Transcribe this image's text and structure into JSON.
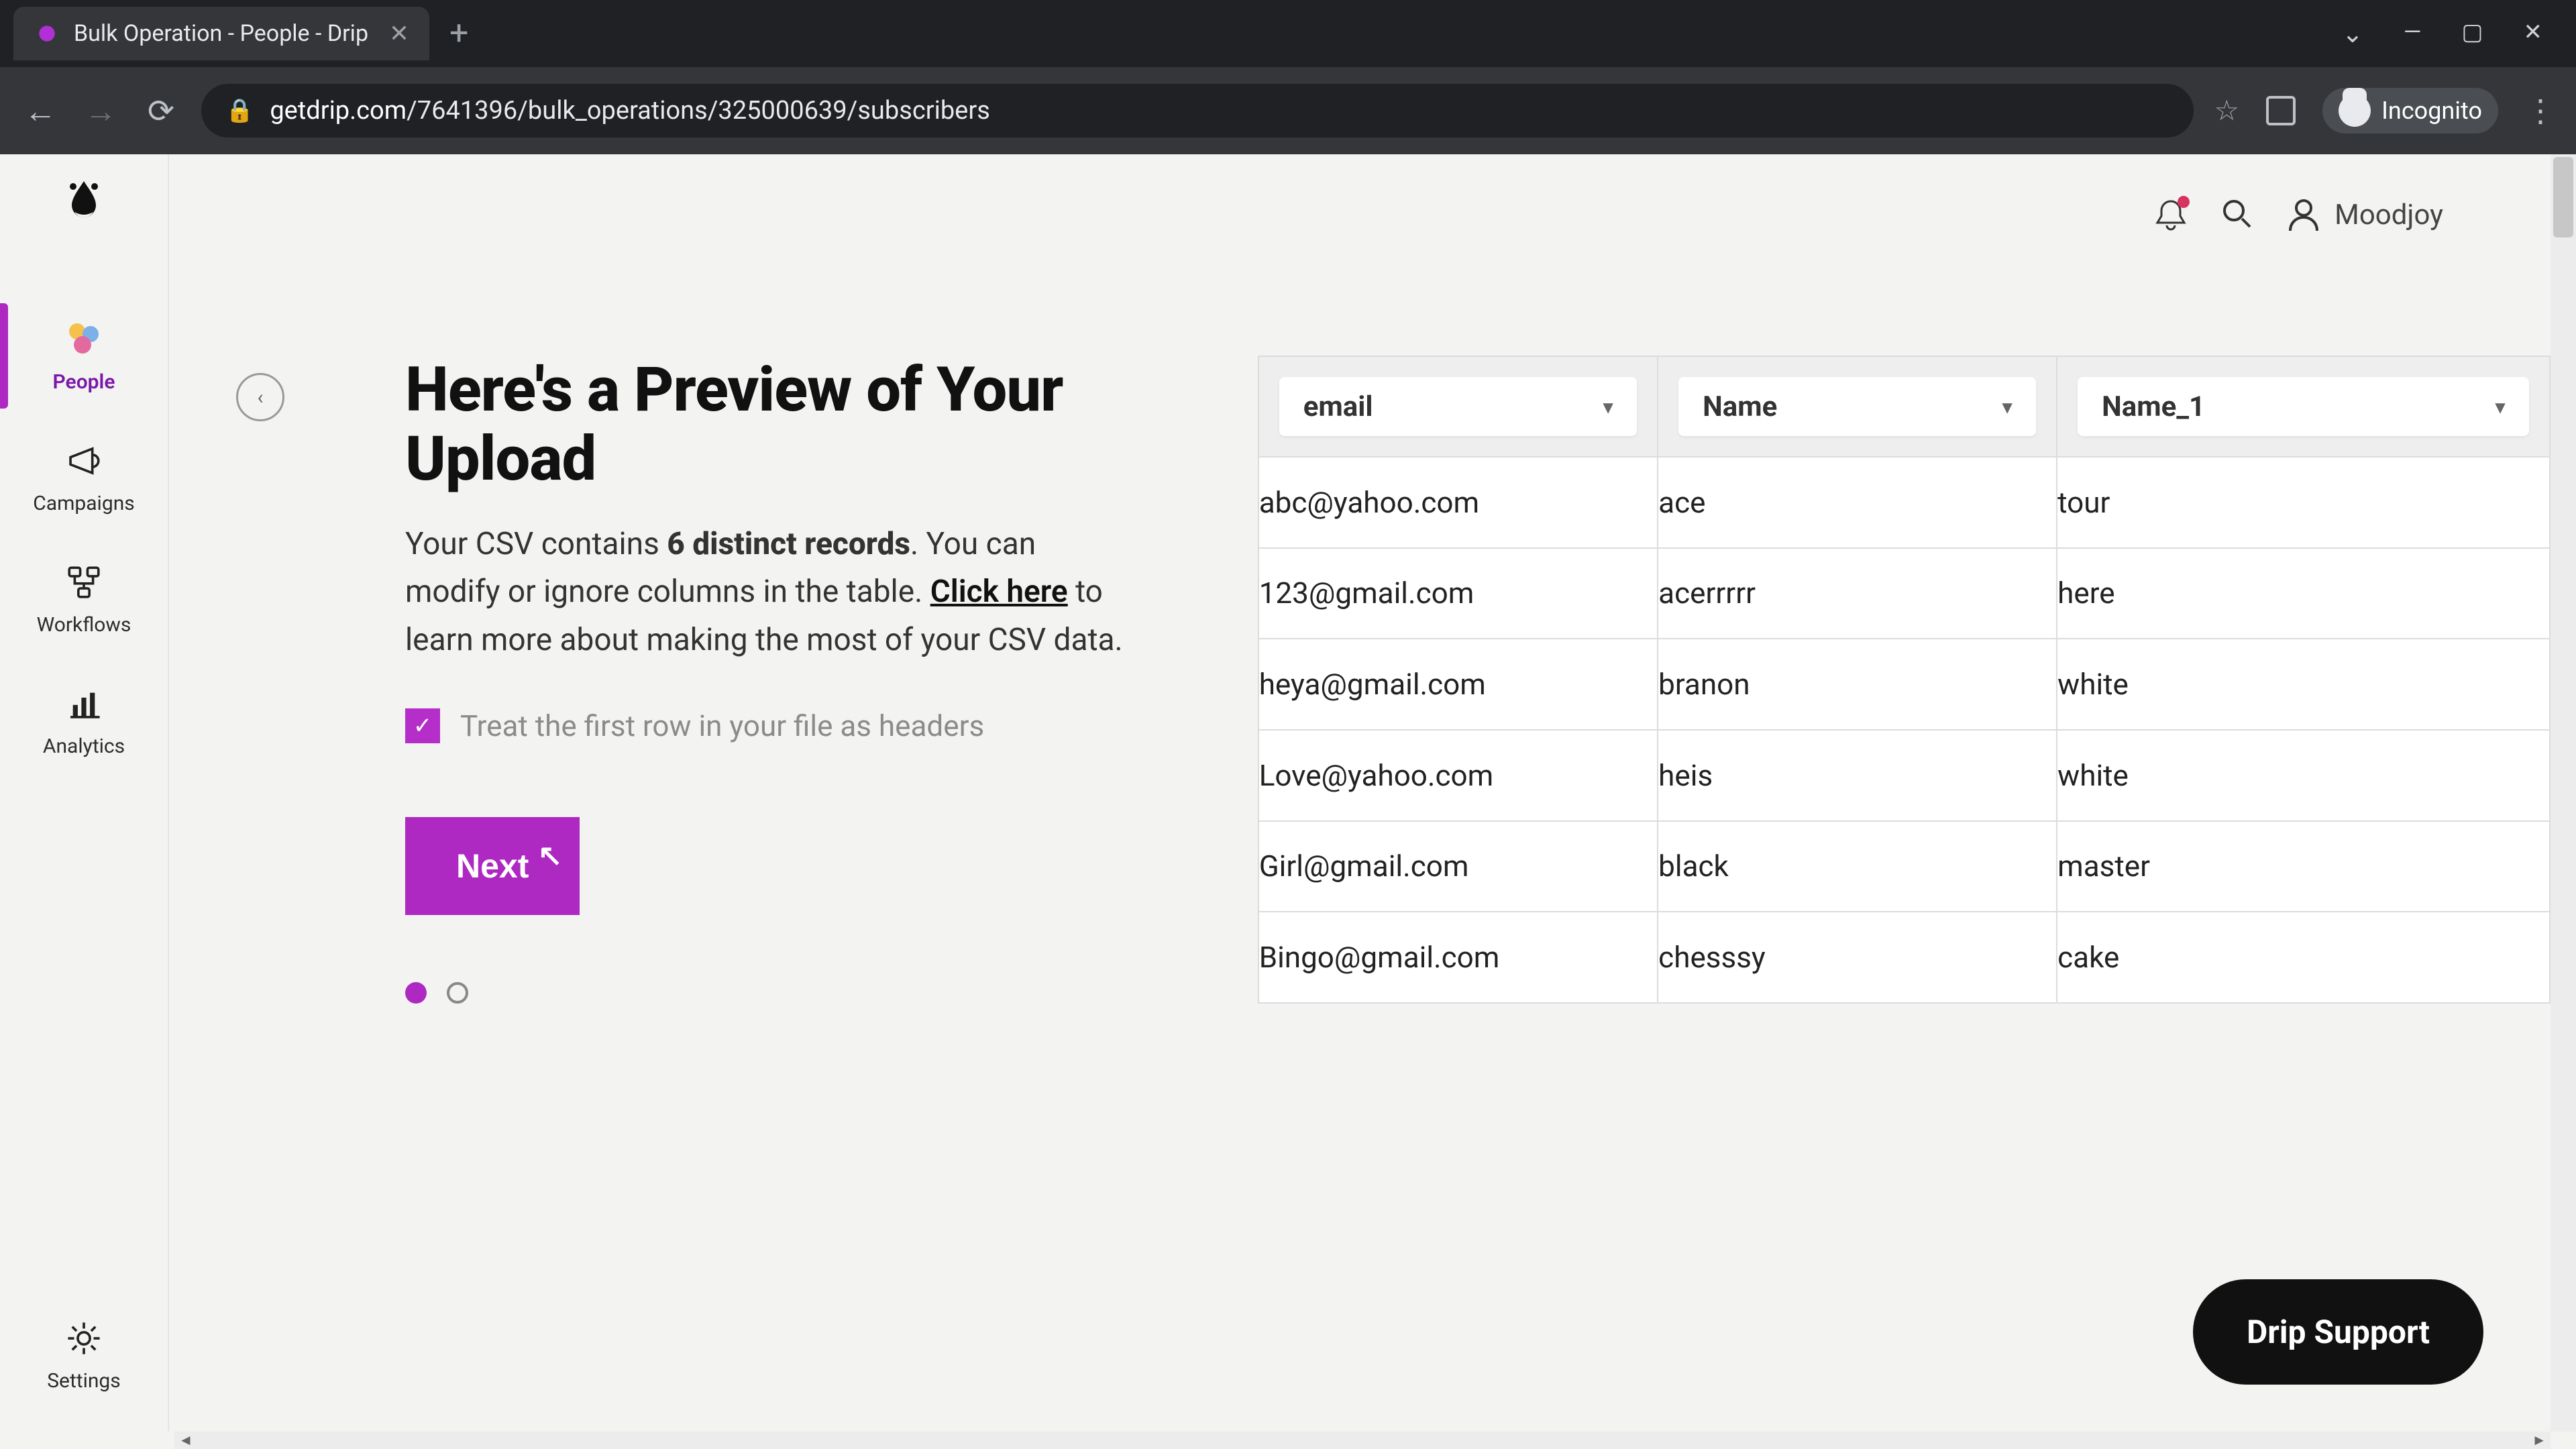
{
  "browser": {
    "tab_title": "Bulk Operation - People - Drip",
    "url_domain": "getdrip.com",
    "url_path": "/7641396/bulk_operations/325000639/subscribers",
    "incognito_label": "Incognito"
  },
  "sidebar": {
    "items": [
      {
        "label": "People",
        "icon": "people"
      },
      {
        "label": "Campaigns",
        "icon": "megaphone"
      },
      {
        "label": "Workflows",
        "icon": "workflow"
      },
      {
        "label": "Analytics",
        "icon": "analytics"
      }
    ],
    "settings_label": "Settings"
  },
  "topbar": {
    "user_name": "Moodjoy"
  },
  "upload": {
    "heading": "Here's a Preview of Your Upload",
    "para_pre": "Your CSV contains ",
    "records_bold": "6 distinct records",
    "para_mid": ". You can modify or ignore columns in the table. ",
    "click_here": "Click here",
    "para_post": " to learn more about making the most of your CSV data.",
    "checkbox_label": "Treat the first row in your file as headers",
    "next_label": "Next"
  },
  "table": {
    "headers": [
      "email",
      "Name",
      "Name_1"
    ],
    "rows": [
      [
        "abc@yahoo.com",
        "ace",
        "tour"
      ],
      [
        "123@gmail.com",
        "acerrrrr",
        "here"
      ],
      [
        "heya@gmail.com",
        "branon",
        "white"
      ],
      [
        "Love@yahoo.com",
        "heis",
        "white"
      ],
      [
        "Girl@gmail.com",
        "black",
        "master"
      ],
      [
        "Bingo@gmail.com",
        "chesssy",
        "cake"
      ]
    ]
  },
  "support_label": "Drip Support"
}
